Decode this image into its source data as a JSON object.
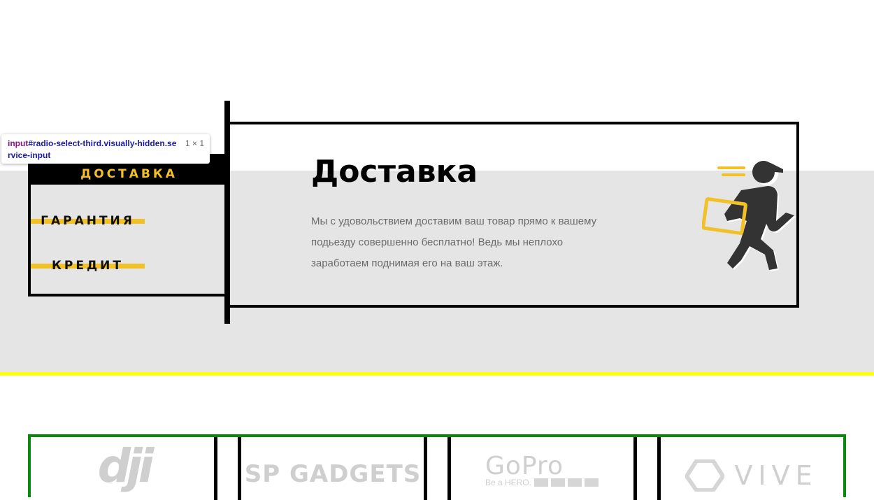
{
  "tabs": [
    {
      "label": "ДОСТАВКА",
      "active": true
    },
    {
      "label": "ГАРАНТИЯ",
      "active": false
    },
    {
      "label": "КРЕДИТ",
      "active": false
    }
  ],
  "panel": {
    "title": "Доставка",
    "text": "Мы с удовольствием доставим ваш товар прямо к вашему подьезду совершенно бесплатно! Ведь мы неплохо заработаем поднимая его на ваш этаж.",
    "illustration_icon": "courier-running-icon"
  },
  "tooltip": {
    "tag": "input",
    "selector": "#radio-select-third.visually-hidden.service-input",
    "dims": "1 × 1"
  },
  "brands": [
    {
      "name": "dji",
      "logo_text": "dji"
    },
    {
      "name": "SP Gadgets",
      "logo_text": "SP GADGETS"
    },
    {
      "name": "GoPro",
      "logo_text": "GoPro",
      "tagline": "Be a HERO."
    },
    {
      "name": "Vive",
      "logo_text": "VIVE"
    }
  ],
  "colors": {
    "accent": "#f2c027",
    "band": "#e5e5e5",
    "band_line": "#ffff00",
    "brands_border": "#0a8a0a",
    "logo_gray": "#cfcfcf"
  }
}
